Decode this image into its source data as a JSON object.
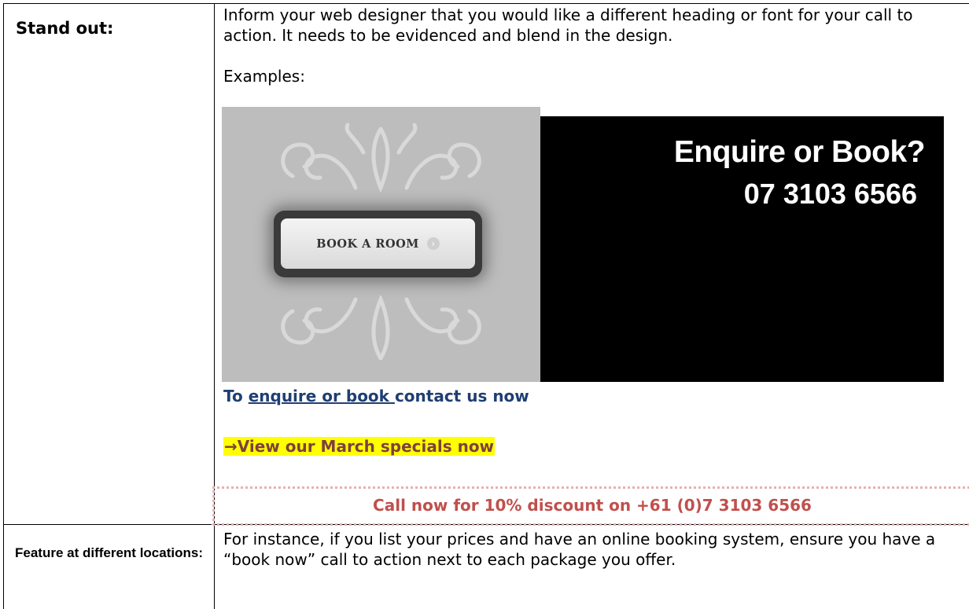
{
  "row1": {
    "label": "Stand out:",
    "paragraph": "Inform your web designer that you would like a different heading or font for your call to action. It needs to be evidenced and blend in the design.",
    "examples_label": "Examples:",
    "example1": {
      "button_text": "BOOK A ROOM"
    },
    "example2": {
      "title": "Enquire or Book?",
      "phone": "07 3103 6566"
    },
    "enquire_line": {
      "prefix": "To ",
      "link": "enquire or book ",
      "suffix": "contact us now"
    },
    "specials": "→View our March specials now",
    "call_now": "Call now for 10% discount on +61 (0)7 3103 6566"
  },
  "row2": {
    "label": "Feature at different locations:",
    "paragraph": "For instance, if you list your prices and have an online booking system, ensure you have a “book now” call to action next to each package you offer."
  },
  "colors": {
    "enquire_blue": "#1f3f73",
    "highlight_yellow": "#ffff00",
    "call_red": "#c0504d"
  }
}
